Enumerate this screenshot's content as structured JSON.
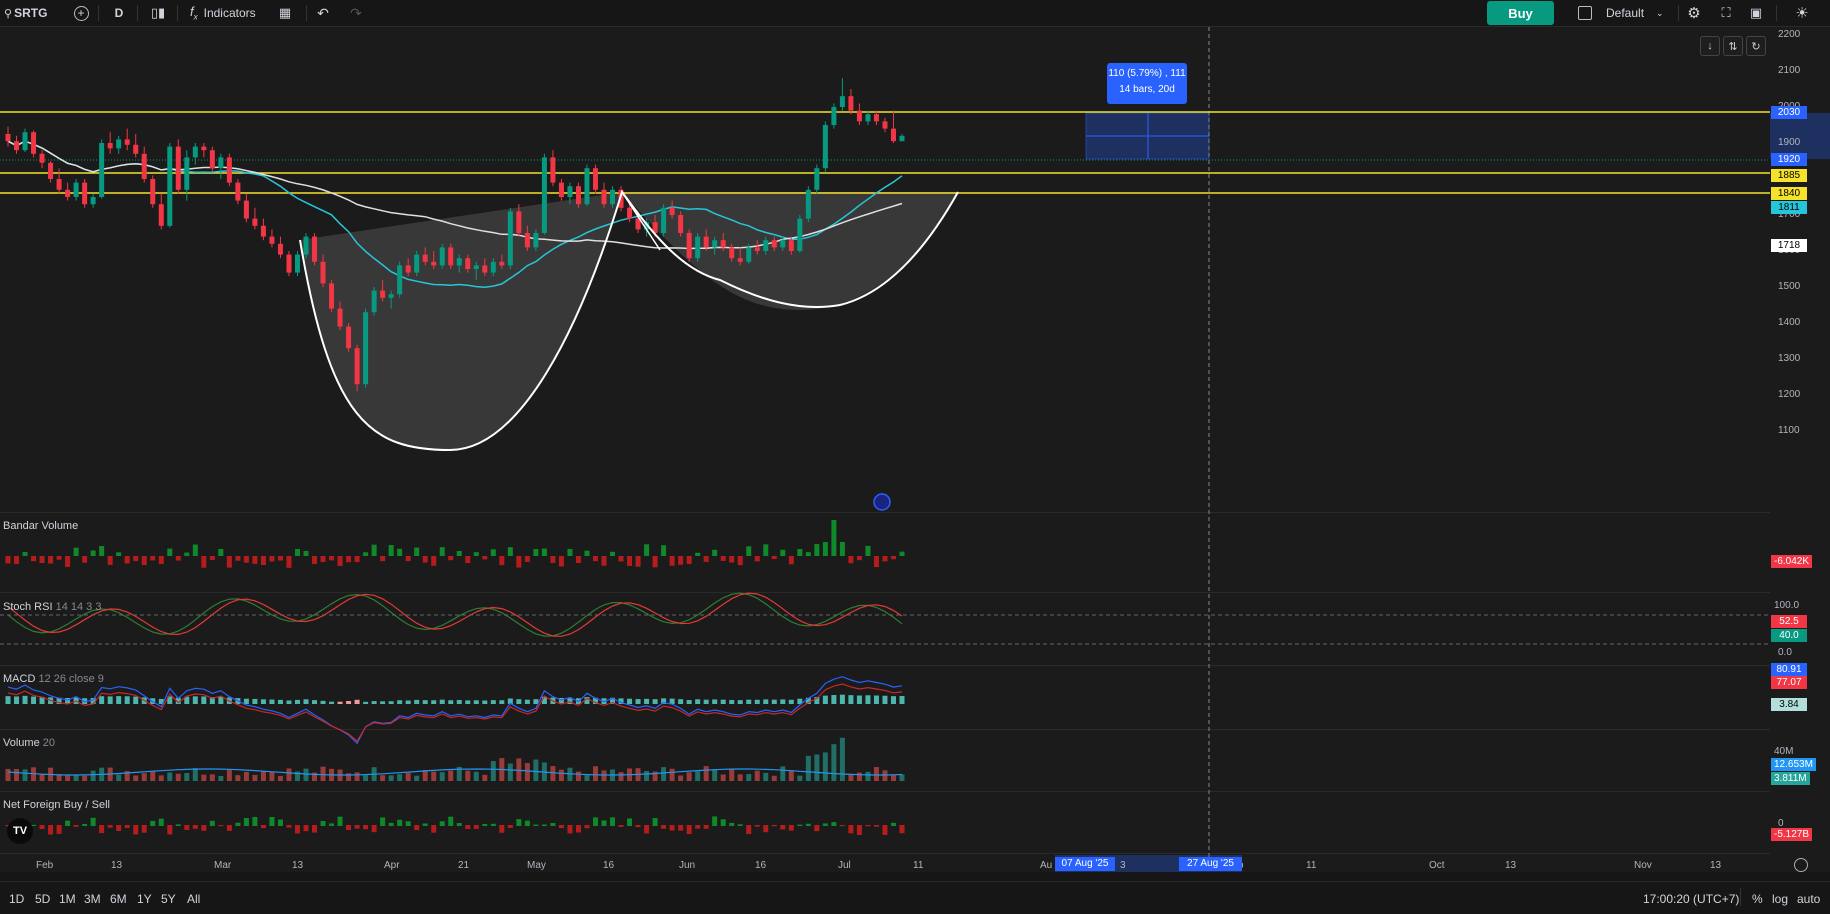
{
  "toolbar": {
    "symbol": "SRTG",
    "interval": "D",
    "indicators_label": "Indicators",
    "buy_label": "Buy",
    "layout_label": "Default"
  },
  "price_axis": {
    "labels": [
      "2200",
      "2100",
      "2000",
      "1900",
      "1800",
      "1700",
      "1600",
      "1500",
      "1400",
      "1300",
      "1200",
      "1100"
    ]
  },
  "price_tags": {
    "t2030": "2030",
    "t1920": "1920",
    "t1885": "1885",
    "t1840": "1840",
    "t1811": "1811",
    "t1718": "1718"
  },
  "measure": {
    "line1": "110 (5.79%) , 111",
    "line2": "14 bars, 20d"
  },
  "panes": {
    "bandar": {
      "title": "Bandar Volume",
      "value": "-6.042K"
    },
    "stoch": {
      "title": "Stoch RSI",
      "params": "14 14 3 3",
      "k": "52.5",
      "d": "40.0",
      "hi": "100.0",
      "lo": "0.0"
    },
    "macd": {
      "title": "MACD",
      "params": "12 26 close 9",
      "macd": "80.91",
      "signal": "77.07",
      "hist": "3.84"
    },
    "volume": {
      "title": "Volume",
      "params": "20",
      "ma": "12.653M",
      "vol": "3.811M",
      "scale": "40M"
    },
    "foreign": {
      "title": "Net Foreign Buy / Sell",
      "zero": "0",
      "value": "-5.127B"
    }
  },
  "time_axis": {
    "labels": [
      "Feb",
      "13",
      "Mar",
      "13",
      "Apr",
      "21",
      "May",
      "16",
      "Jun",
      "16",
      "Jul",
      "11",
      "Au",
      "3",
      "o",
      "11",
      "Oct",
      "13",
      "Nov",
      "13"
    ],
    "marker_start": "07 Aug '25",
    "marker_end": "27 Aug '25"
  },
  "bottom": {
    "ranges": [
      "1D",
      "5D",
      "1M",
      "3M",
      "6M",
      "1Y",
      "5Y",
      "All"
    ],
    "clock": "17:00:20 (UTC+7)",
    "pct": "%",
    "log": "log",
    "auto": "auto"
  },
  "logo_text": "TV",
  "chart_data": {
    "type": "candlestick",
    "symbol": "SRTG",
    "interval": "D",
    "ylim": [
      1100,
      2200
    ],
    "horizontal_levels": [
      2030,
      1885,
      1840
    ],
    "last_close": 1920,
    "ma_values": [
      1811,
      1718
    ],
    "candles": [
      {
        "o": 1925,
        "h": 1945,
        "l": 1890,
        "c": 1905
      },
      {
        "o": 1905,
        "h": 1920,
        "l": 1870,
        "c": 1880
      },
      {
        "o": 1880,
        "h": 1940,
        "l": 1875,
        "c": 1930
      },
      {
        "o": 1930,
        "h": 1935,
        "l": 1860,
        "c": 1870
      },
      {
        "o": 1870,
        "h": 1880,
        "l": 1830,
        "c": 1845
      },
      {
        "o": 1845,
        "h": 1850,
        "l": 1790,
        "c": 1800
      },
      {
        "o": 1800,
        "h": 1830,
        "l": 1760,
        "c": 1770
      },
      {
        "o": 1770,
        "h": 1790,
        "l": 1740,
        "c": 1750
      },
      {
        "o": 1750,
        "h": 1800,
        "l": 1740,
        "c": 1790
      },
      {
        "o": 1790,
        "h": 1800,
        "l": 1720,
        "c": 1730
      },
      {
        "o": 1730,
        "h": 1760,
        "l": 1720,
        "c": 1750
      },
      {
        "o": 1750,
        "h": 1910,
        "l": 1745,
        "c": 1900
      },
      {
        "o": 1900,
        "h": 1930,
        "l": 1870,
        "c": 1885
      },
      {
        "o": 1885,
        "h": 1920,
        "l": 1870,
        "c": 1910
      },
      {
        "o": 1910,
        "h": 1940,
        "l": 1880,
        "c": 1895
      },
      {
        "o": 1895,
        "h": 1925,
        "l": 1860,
        "c": 1870
      },
      {
        "o": 1870,
        "h": 1890,
        "l": 1790,
        "c": 1800
      },
      {
        "o": 1800,
        "h": 1810,
        "l": 1720,
        "c": 1730
      },
      {
        "o": 1730,
        "h": 1760,
        "l": 1660,
        "c": 1670
      },
      {
        "o": 1670,
        "h": 1900,
        "l": 1665,
        "c": 1890
      },
      {
        "o": 1890,
        "h": 1910,
        "l": 1760,
        "c": 1770
      },
      {
        "o": 1770,
        "h": 1880,
        "l": 1740,
        "c": 1860
      },
      {
        "o": 1860,
        "h": 1900,
        "l": 1840,
        "c": 1890
      },
      {
        "o": 1890,
        "h": 1900,
        "l": 1860,
        "c": 1880
      },
      {
        "o": 1880,
        "h": 1890,
        "l": 1820,
        "c": 1830
      },
      {
        "o": 1830,
        "h": 1870,
        "l": 1800,
        "c": 1860
      },
      {
        "o": 1860,
        "h": 1870,
        "l": 1780,
        "c": 1790
      },
      {
        "o": 1790,
        "h": 1800,
        "l": 1730,
        "c": 1740
      },
      {
        "o": 1740,
        "h": 1760,
        "l": 1680,
        "c": 1690
      },
      {
        "o": 1690,
        "h": 1720,
        "l": 1660,
        "c": 1670
      },
      {
        "o": 1670,
        "h": 1690,
        "l": 1630,
        "c": 1640
      },
      {
        "o": 1640,
        "h": 1660,
        "l": 1610,
        "c": 1620
      },
      {
        "o": 1620,
        "h": 1640,
        "l": 1580,
        "c": 1590
      },
      {
        "o": 1590,
        "h": 1600,
        "l": 1530,
        "c": 1540
      },
      {
        "o": 1540,
        "h": 1600,
        "l": 1530,
        "c": 1590
      },
      {
        "o": 1590,
        "h": 1650,
        "l": 1580,
        "c": 1640
      },
      {
        "o": 1640,
        "h": 1650,
        "l": 1560,
        "c": 1570
      },
      {
        "o": 1570,
        "h": 1590,
        "l": 1500,
        "c": 1510
      },
      {
        "o": 1510,
        "h": 1520,
        "l": 1430,
        "c": 1440
      },
      {
        "o": 1440,
        "h": 1460,
        "l": 1380,
        "c": 1390
      },
      {
        "o": 1390,
        "h": 1400,
        "l": 1320,
        "c": 1330
      },
      {
        "o": 1330,
        "h": 1340,
        "l": 1210,
        "c": 1230
      },
      {
        "o": 1230,
        "h": 1440,
        "l": 1220,
        "c": 1430
      },
      {
        "o": 1430,
        "h": 1500,
        "l": 1420,
        "c": 1490
      },
      {
        "o": 1490,
        "h": 1520,
        "l": 1460,
        "c": 1470
      },
      {
        "o": 1470,
        "h": 1490,
        "l": 1440,
        "c": 1480
      },
      {
        "o": 1480,
        "h": 1570,
        "l": 1470,
        "c": 1560
      },
      {
        "o": 1560,
        "h": 1580,
        "l": 1530,
        "c": 1540
      },
      {
        "o": 1540,
        "h": 1600,
        "l": 1530,
        "c": 1590
      },
      {
        "o": 1590,
        "h": 1610,
        "l": 1560,
        "c": 1570
      },
      {
        "o": 1570,
        "h": 1600,
        "l": 1550,
        "c": 1560
      },
      {
        "o": 1560,
        "h": 1620,
        "l": 1550,
        "c": 1610
      },
      {
        "o": 1610,
        "h": 1620,
        "l": 1550,
        "c": 1560
      },
      {
        "o": 1560,
        "h": 1590,
        "l": 1540,
        "c": 1580
      },
      {
        "o": 1580,
        "h": 1590,
        "l": 1540,
        "c": 1550
      },
      {
        "o": 1550,
        "h": 1570,
        "l": 1520,
        "c": 1560
      },
      {
        "o": 1560,
        "h": 1580,
        "l": 1530,
        "c": 1540
      },
      {
        "o": 1540,
        "h": 1580,
        "l": 1530,
        "c": 1570
      },
      {
        "o": 1570,
        "h": 1590,
        "l": 1550,
        "c": 1560
      },
      {
        "o": 1560,
        "h": 1720,
        "l": 1550,
        "c": 1710
      },
      {
        "o": 1710,
        "h": 1730,
        "l": 1640,
        "c": 1650
      },
      {
        "o": 1650,
        "h": 1670,
        "l": 1600,
        "c": 1610
      },
      {
        "o": 1610,
        "h": 1660,
        "l": 1600,
        "c": 1650
      },
      {
        "o": 1650,
        "h": 1870,
        "l": 1645,
        "c": 1860
      },
      {
        "o": 1860,
        "h": 1880,
        "l": 1780,
        "c": 1790
      },
      {
        "o": 1790,
        "h": 1800,
        "l": 1740,
        "c": 1750
      },
      {
        "o": 1750,
        "h": 1790,
        "l": 1730,
        "c": 1780
      },
      {
        "o": 1780,
        "h": 1790,
        "l": 1720,
        "c": 1730
      },
      {
        "o": 1730,
        "h": 1840,
        "l": 1725,
        "c": 1830
      },
      {
        "o": 1830,
        "h": 1840,
        "l": 1760,
        "c": 1770
      },
      {
        "o": 1770,
        "h": 1790,
        "l": 1720,
        "c": 1730
      },
      {
        "o": 1730,
        "h": 1780,
        "l": 1720,
        "c": 1770
      },
      {
        "o": 1770,
        "h": 1780,
        "l": 1710,
        "c": 1720
      },
      {
        "o": 1720,
        "h": 1740,
        "l": 1680,
        "c": 1690
      },
      {
        "o": 1690,
        "h": 1710,
        "l": 1650,
        "c": 1660
      },
      {
        "o": 1660,
        "h": 1690,
        "l": 1640,
        "c": 1680
      },
      {
        "o": 1680,
        "h": 1700,
        "l": 1640,
        "c": 1650
      },
      {
        "o": 1650,
        "h": 1730,
        "l": 1640,
        "c": 1720
      },
      {
        "o": 1720,
        "h": 1740,
        "l": 1690,
        "c": 1700
      },
      {
        "o": 1700,
        "h": 1710,
        "l": 1640,
        "c": 1650
      },
      {
        "o": 1650,
        "h": 1660,
        "l": 1570,
        "c": 1580
      },
      {
        "o": 1580,
        "h": 1650,
        "l": 1570,
        "c": 1640
      },
      {
        "o": 1640,
        "h": 1660,
        "l": 1600,
        "c": 1610
      },
      {
        "o": 1610,
        "h": 1640,
        "l": 1590,
        "c": 1630
      },
      {
        "o": 1630,
        "h": 1650,
        "l": 1600,
        "c": 1610
      },
      {
        "o": 1610,
        "h": 1620,
        "l": 1570,
        "c": 1580
      },
      {
        "o": 1580,
        "h": 1610,
        "l": 1560,
        "c": 1570
      },
      {
        "o": 1570,
        "h": 1620,
        "l": 1565,
        "c": 1610
      },
      {
        "o": 1610,
        "h": 1630,
        "l": 1590,
        "c": 1600
      },
      {
        "o": 1600,
        "h": 1640,
        "l": 1590,
        "c": 1630
      },
      {
        "o": 1630,
        "h": 1640,
        "l": 1600,
        "c": 1610
      },
      {
        "o": 1610,
        "h": 1640,
        "l": 1600,
        "c": 1630
      },
      {
        "o": 1630,
        "h": 1640,
        "l": 1590,
        "c": 1600
      },
      {
        "o": 1600,
        "h": 1700,
        "l": 1595,
        "c": 1690
      },
      {
        "o": 1690,
        "h": 1780,
        "l": 1680,
        "c": 1770
      },
      {
        "o": 1770,
        "h": 1840,
        "l": 1760,
        "c": 1830
      },
      {
        "o": 1830,
        "h": 1960,
        "l": 1820,
        "c": 1950
      },
      {
        "o": 1950,
        "h": 2010,
        "l": 1940,
        "c": 2000
      },
      {
        "o": 2000,
        "h": 2080,
        "l": 1990,
        "c": 2030
      },
      {
        "o": 2030,
        "h": 2050,
        "l": 1980,
        "c": 1990
      },
      {
        "o": 1990,
        "h": 2010,
        "l": 1950,
        "c": 1960
      },
      {
        "o": 1960,
        "h": 1990,
        "l": 1950,
        "c": 1980
      },
      {
        "o": 1980,
        "h": 1990,
        "l": 1950,
        "c": 1960
      },
      {
        "o": 1960,
        "h": 1970,
        "l": 1930,
        "c": 1940
      },
      {
        "o": 1940,
        "h": 1990,
        "l": 1900,
        "c": 1905
      },
      {
        "o": 1905,
        "h": 1925,
        "l": 1905,
        "c": 1920
      }
    ]
  },
  "colors": {
    "up": "#089981",
    "down": "#f23645",
    "ma_fast": "#26c6da",
    "ma_slow": "#e0e0e0",
    "level": "#f5e22a",
    "buy": "#089981",
    "measure": "#2962ff"
  }
}
